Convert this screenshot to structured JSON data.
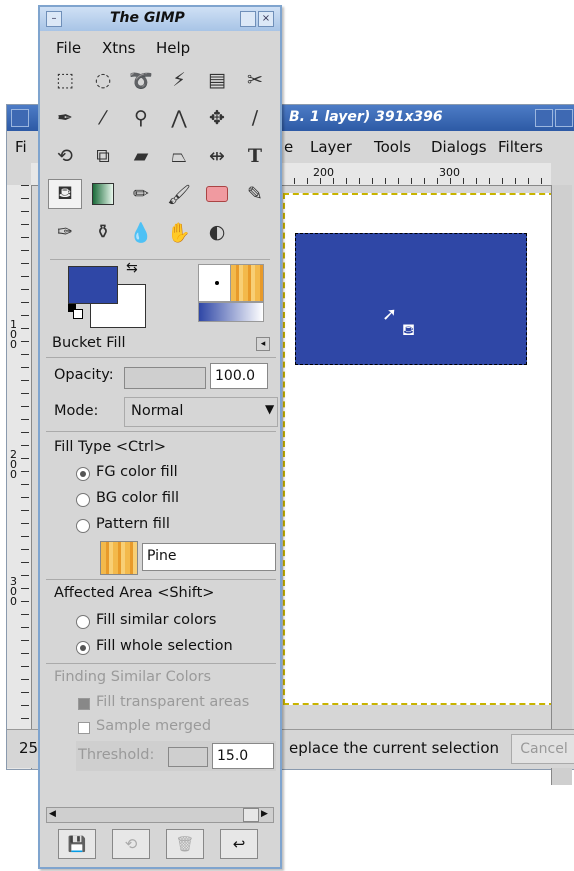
{
  "image_window": {
    "title": "B. 1 layer) 391x396",
    "menu": [
      "Fi",
      "e",
      "Layer",
      "Tools",
      "Dialogs",
      "Filters"
    ],
    "ruler_h": [
      "200",
      "300"
    ],
    "ruler_v": [
      "1 0 0",
      "2 0 0",
      "3 0 0"
    ],
    "status_zoom": "25",
    "status_text": "eplace the current selection",
    "cancel_label": "Cancel"
  },
  "toolbox": {
    "title": "The GIMP",
    "menu": [
      "File",
      "Xtns",
      "Help"
    ],
    "tools": [
      "rect-select-icon",
      "ellipse-select-icon",
      "lasso-icon",
      "magic-wand-icon",
      "select-by-color-icon",
      "scissors-icon",
      "paths-icon",
      "color-picker-icon",
      "zoom-icon",
      "measure-icon",
      "move-icon",
      "knife-icon",
      "rotate-icon",
      "scale-icon",
      "shear-icon",
      "perspective-icon",
      "flip-icon",
      "text-icon",
      "bucket-fill-icon",
      "gradient-icon",
      "pencil-icon",
      "paintbrush-icon",
      "eraser-icon",
      "airbrush-icon",
      "ink-icon",
      "clone-icon",
      "blur-icon",
      "smudge-icon",
      "dodge-icon"
    ],
    "colors": {
      "fg": "#2f47a6",
      "bg": "#ffffff"
    },
    "options": {
      "title": "Bucket Fill",
      "opacity_label": "Opacity:",
      "opacity_value": "100.0",
      "mode_label": "Mode:",
      "mode_value": "Normal",
      "fill_type_label": "Fill Type  <Ctrl>",
      "fill_types": [
        "FG color fill",
        "BG color fill",
        "Pattern fill"
      ],
      "fill_type_selected": 0,
      "pattern_name": "Pine",
      "affected_label": "Affected Area  <Shift>",
      "affected": [
        "Fill similar colors",
        "Fill whole selection"
      ],
      "affected_selected": 1,
      "similar_label": "Finding Similar Colors",
      "fill_transparent": "Fill transparent areas",
      "sample_merged": "Sample merged",
      "threshold_label": "Threshold:",
      "threshold_value": "15.0"
    }
  }
}
